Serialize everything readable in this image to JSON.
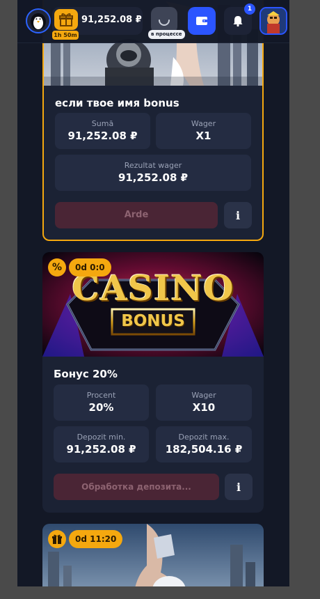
{
  "header": {
    "balance": "91,252.08 ₽",
    "gift_timer": "1h 50m",
    "processing_label": "в процессе",
    "notification_count": "1"
  },
  "cards": [
    {
      "title": "если твое имя bonus",
      "stats": [
        {
          "label": "Sumă",
          "value": "91,252.08 ₽"
        },
        {
          "label": "Wager",
          "value": "X1"
        },
        {
          "label": "Rezultat wager",
          "value": "91,252.08 ₽"
        }
      ],
      "action_label": "Arde",
      "info_label": "i"
    },
    {
      "badge_icon": "%",
      "timer": "0d 0:0",
      "banner_title": "CASINO",
      "banner_subtitle": "BONUS",
      "title": "Бонус 20%",
      "stats": [
        {
          "label": "Procent",
          "value": "20%"
        },
        {
          "label": "Wager",
          "value": "X10"
        },
        {
          "label": "Depozit min.",
          "value": "91,252.08 ₽"
        },
        {
          "label": "Depozit max.",
          "value": "182,504.16 ₽"
        }
      ],
      "action_label": "Обработка депозита...",
      "info_label": "i"
    },
    {
      "timer": "0d 11:20"
    }
  ],
  "colors": {
    "accent_gold": "#f5a80f",
    "accent_blue": "#2b55ff",
    "card_bg": "#1b2234",
    "page_bg": "#131826"
  }
}
